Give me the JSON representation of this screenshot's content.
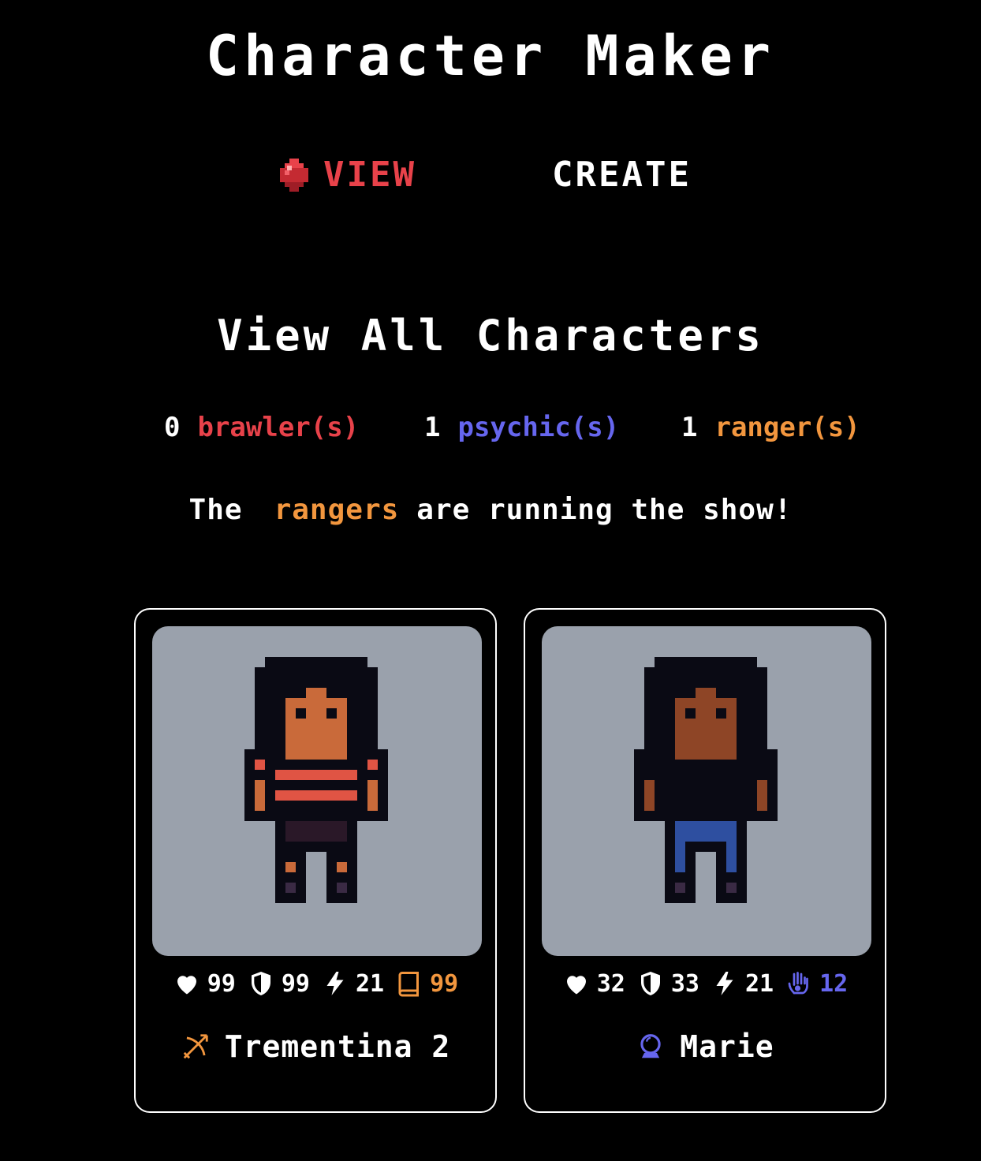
{
  "app": {
    "title": "Character Maker"
  },
  "nav": {
    "view_label": "VIEW",
    "create_label": "CREATE",
    "active_color": "#e8424a",
    "active_icon": "red-gem-icon"
  },
  "view": {
    "heading": "View All Characters",
    "counts": [
      {
        "count": "0",
        "label": "brawler(s)",
        "color": "#e8424a"
      },
      {
        "count": "1",
        "label": "psychic(s)",
        "color": "#6666ee"
      },
      {
        "count": "1",
        "label": "ranger(s)",
        "color": "#f2963e"
      }
    ],
    "message": {
      "prefix": "The",
      "highlight": "rangers",
      "suffix": "are running the show!",
      "highlight_color": "#f2963e"
    }
  },
  "characters": [
    {
      "name": "Trementina 2",
      "class_icon": "crossbow-icon",
      "class_color": "#f2963e",
      "stats": {
        "health": "99",
        "defense": "99",
        "speed": "21",
        "special": "99",
        "special_icon": "book-icon",
        "special_color": "#f2963e"
      },
      "look": {
        "skin": "#c96a3a",
        "shirt": "stripes-red",
        "pants": "#2a1828"
      }
    },
    {
      "name": "Marie",
      "class_icon": "crystal-ball-icon",
      "class_color": "#6666ee",
      "stats": {
        "health": "32",
        "defense": "33",
        "speed": "21",
        "special": "12",
        "special_icon": "psychic-hand-icon",
        "special_color": "#6666ee"
      },
      "look": {
        "skin": "#8e4526",
        "shirt": "plain-black",
        "pants": "#2e4fa0"
      }
    }
  ]
}
